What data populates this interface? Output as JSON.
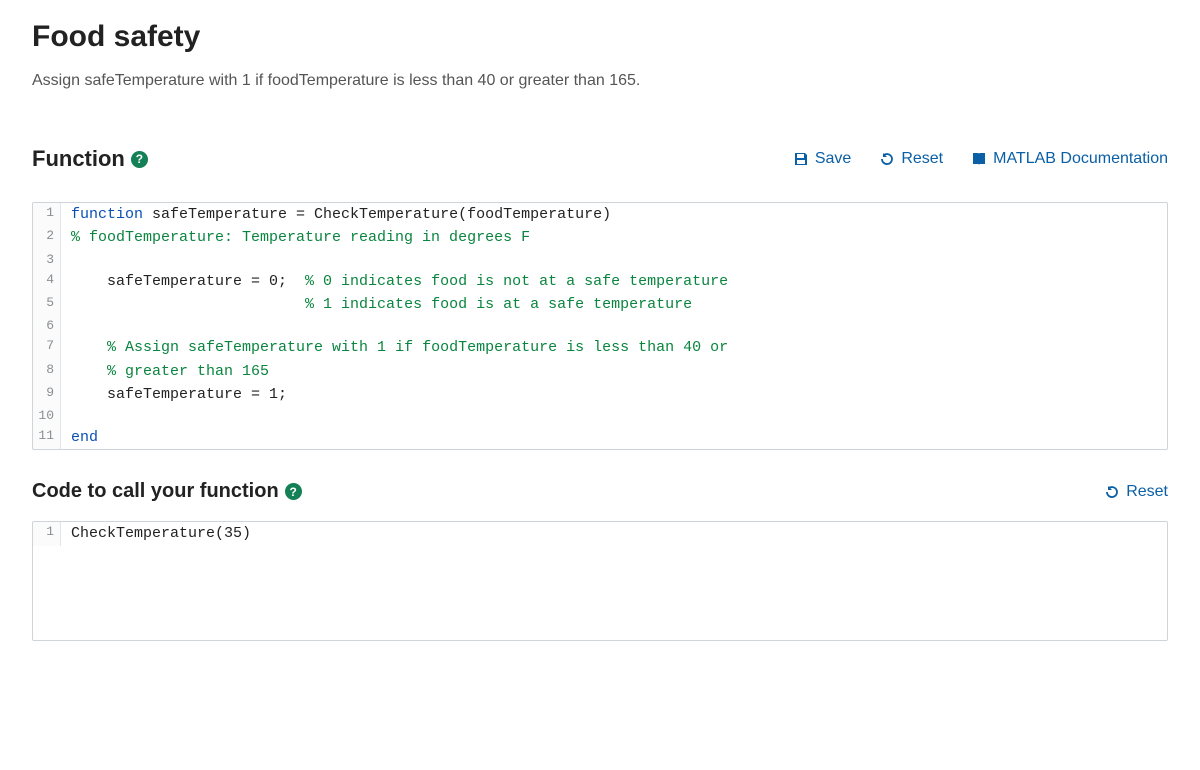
{
  "title": "Food safety",
  "instructions": "Assign safeTemperature with 1 if foodTemperature is less than 40 or greater than 165.",
  "function_section": {
    "heading": "Function",
    "help_symbol": "?",
    "toolbar": {
      "save": "Save",
      "reset": "Reset",
      "docs": "MATLAB Documentation"
    },
    "code_lines": [
      {
        "n": "1",
        "segments": [
          {
            "t": "function",
            "c": "kw"
          },
          {
            "t": " safeTemperature = CheckTemperature(foodTemperature)",
            "c": ""
          }
        ]
      },
      {
        "n": "2",
        "segments": [
          {
            "t": "% foodTemperature: Temperature reading in degrees F",
            "c": "com"
          }
        ]
      },
      {
        "n": "3",
        "segments": [
          {
            "t": "",
            "c": ""
          }
        ]
      },
      {
        "n": "4",
        "segments": [
          {
            "t": "    safeTemperature = 0;  ",
            "c": ""
          },
          {
            "t": "% 0 indicates food is not at a safe temperature",
            "c": "com"
          }
        ]
      },
      {
        "n": "5",
        "segments": [
          {
            "t": "                          ",
            "c": ""
          },
          {
            "t": "% 1 indicates food is at a safe temperature",
            "c": "com"
          }
        ]
      },
      {
        "n": "6",
        "segments": [
          {
            "t": "",
            "c": ""
          }
        ]
      },
      {
        "n": "7",
        "segments": [
          {
            "t": "    ",
            "c": ""
          },
          {
            "t": "% Assign safeTemperature with 1 if foodTemperature is less than 40 or",
            "c": "com"
          }
        ]
      },
      {
        "n": "8",
        "segments": [
          {
            "t": "    ",
            "c": ""
          },
          {
            "t": "% greater than 165",
            "c": "com"
          }
        ]
      },
      {
        "n": "9",
        "segments": [
          {
            "t": "    safeTemperature = 1;",
            "c": ""
          }
        ]
      },
      {
        "n": "10",
        "segments": [
          {
            "t": "",
            "c": ""
          }
        ]
      },
      {
        "n": "11",
        "segments": [
          {
            "t": "end",
            "c": "kw"
          }
        ]
      }
    ]
  },
  "call_section": {
    "heading": "Code to call your function",
    "help_symbol": "?",
    "reset": "Reset",
    "code_lines": [
      {
        "n": "1",
        "segments": [
          {
            "t": "CheckTemperature(35)",
            "c": ""
          }
        ]
      }
    ]
  }
}
